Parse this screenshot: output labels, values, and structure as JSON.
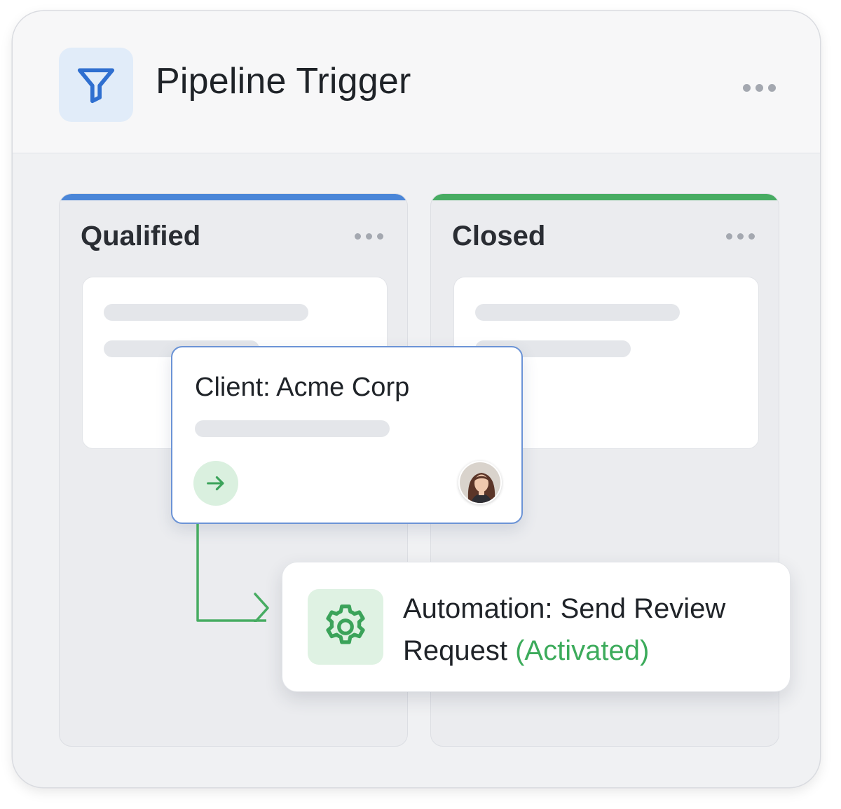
{
  "header": {
    "title": "Pipeline Trigger",
    "icon": "funnel-icon",
    "menu_icon": "more-horizontal-icon"
  },
  "columns": [
    {
      "title": "Qualified",
      "accent": "#4a86d8",
      "menu_icon": "more-horizontal-icon"
    },
    {
      "title": "Closed",
      "accent": "#47ac62",
      "menu_icon": "more-horizontal-icon"
    }
  ],
  "client_card": {
    "title": "Client: Acme Corp",
    "action_icon": "arrow-right-icon",
    "avatar": "user-avatar",
    "border_color": "#6b93d6"
  },
  "automation": {
    "label": "Automation: Send Review",
    "label_line2": "Request",
    "status": "(Activated)",
    "icon": "gear-icon",
    "status_color": "#3cab5b"
  }
}
